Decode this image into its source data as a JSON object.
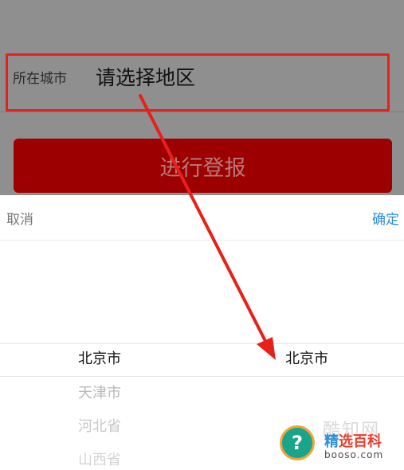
{
  "form": {
    "city_label": "所在城市",
    "city_value": "请选择地区",
    "submit_label": "进行登报"
  },
  "picker": {
    "cancel_label": "取消",
    "confirm_label": "确定",
    "province_options": [
      "北京市",
      "天津市",
      "河北省",
      "山西省"
    ],
    "selected_province": "北京市",
    "selected_city": "北京市"
  },
  "watermark": {
    "faint_text": "酷知网",
    "name_first": "精",
    "name_rest": "选百科",
    "domain": "booso.com",
    "icon_glyph": "?"
  },
  "colors": {
    "accent_red": "#9c0000",
    "annotation_red": "#e8201a",
    "confirm_blue": "#2b8cde"
  }
}
